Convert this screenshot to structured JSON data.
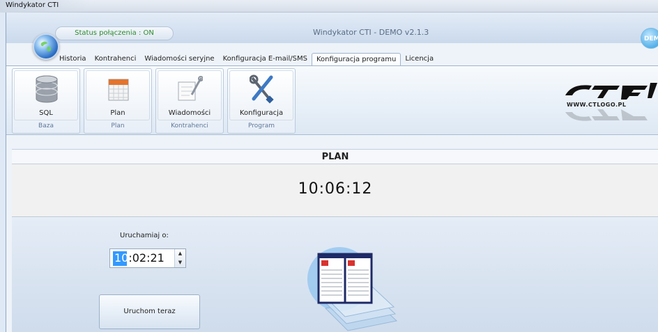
{
  "window": {
    "title": "Windykator CTI"
  },
  "header": {
    "status": "Status połączenia : ON",
    "caption": "Windykator CTI  - DEMO v2.1.3",
    "badge": "DEM"
  },
  "tabs": [
    {
      "label": "Historia"
    },
    {
      "label": "Kontrahenci"
    },
    {
      "label": "Wiadomości seryjne"
    },
    {
      "label": "Konfiguracja E-mail/SMS"
    },
    {
      "label": "Konfiguracja programu"
    },
    {
      "label": "Licencja"
    }
  ],
  "ribbon": {
    "groups": [
      {
        "button": "SQL",
        "group": "Baza",
        "icon": "database-icon"
      },
      {
        "button": "Plan",
        "group": "Plan",
        "icon": "calendar-icon"
      },
      {
        "button": "Wiadomości",
        "group": "Kontrahenci",
        "icon": "message-icon"
      },
      {
        "button": "Konfiguracja",
        "group": "Program",
        "icon": "tools-icon"
      }
    ],
    "logo_url": "WWW.CTLOGO.PL"
  },
  "plan": {
    "header": "PLAN",
    "clock": "10:06:12",
    "run_label": "Uruchamiaj o:",
    "time_hours": "10",
    "time_rest": ":02:21",
    "run_now": "Uruchom teraz"
  },
  "colors": {
    "accent": "#3399ff",
    "status_ok": "#2e8b2e"
  }
}
